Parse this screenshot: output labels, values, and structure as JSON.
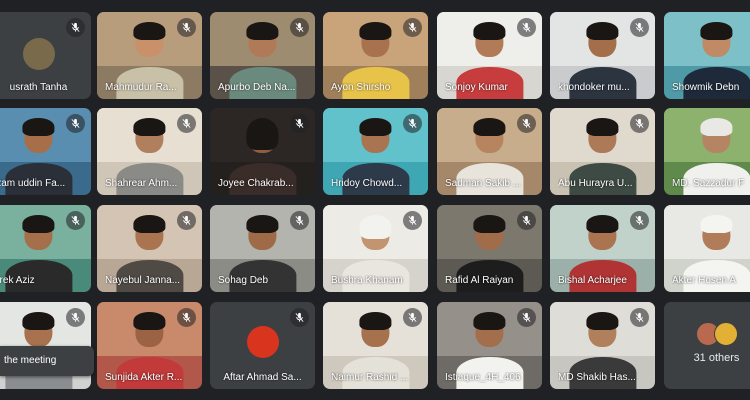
{
  "meeting": {
    "participants": [
      {
        "name": "Nusrath Tanha",
        "shown_name": "usrath Tanha",
        "muted": true,
        "avatar": "photo-icon"
      },
      {
        "name": "Mahmudur Ra...",
        "shown_name": "Mahmudur Ra...",
        "muted": true
      },
      {
        "name": "Apurbo Deb Na...",
        "shown_name": "Apurbo Deb Na...",
        "muted": true
      },
      {
        "name": "Ayon Shirsho",
        "shown_name": "Ayon Shirsho",
        "muted": true
      },
      {
        "name": "Sonjoy Kumar",
        "shown_name": "Sonjoy Kumar",
        "muted": true
      },
      {
        "name": "khondoker mu...",
        "shown_name": "khondoker mu...",
        "muted": true
      },
      {
        "name": "Showmik Debn...",
        "shown_name": "Showmik Debn",
        "muted": false
      },
      {
        "name": "Nizam uddin Fa...",
        "shown_name": "izam uddin Fa...",
        "muted": true
      },
      {
        "name": "Shahrear Ahm...",
        "shown_name": "Shahrear Ahm...",
        "muted": true
      },
      {
        "name": "Joyee Chakrab...",
        "shown_name": "Joyee Chakrab...",
        "muted": true
      },
      {
        "name": "Hridoy Chowd...",
        "shown_name": "Hridoy Chowd...",
        "muted": true
      },
      {
        "name": "Sadman Sakib ...",
        "shown_name": "Sadman Sakib ...",
        "muted": true
      },
      {
        "name": "Abu Hurayra U...",
        "shown_name": "Abu Hurayra U...",
        "muted": true
      },
      {
        "name": "MD. Sazzadur R...",
        "shown_name": "MD. Sazzadur F",
        "muted": false
      },
      {
        "name": "Tarek Aziz",
        "shown_name": "arek Aziz",
        "muted": true
      },
      {
        "name": "Nayebul Janna...",
        "shown_name": "Nayebul Janna...",
        "muted": true
      },
      {
        "name": "Sohag Deb",
        "shown_name": "Sohag Deb",
        "muted": true
      },
      {
        "name": "Bushra Khanam",
        "shown_name": "Bushra Khanam",
        "muted": true
      },
      {
        "name": "Rafid Al Raiyan",
        "shown_name": "Rafid Al Raiyan",
        "muted": true
      },
      {
        "name": "Bishal Acharjee",
        "shown_name": "Bishal Acharjee",
        "muted": true
      },
      {
        "name": "Akter Hosen A...",
        "shown_name": "Akter Hosen A",
        "muted": false
      },
      {
        "name": "",
        "shown_name": "",
        "muted": true
      },
      {
        "name": "Sunjida Akter R...",
        "shown_name": "Sunjida Akter R...",
        "muted": true
      },
      {
        "name": "Aftar Ahmad Sa...",
        "shown_name": "Aftar Ahmad Sa...",
        "muted": true,
        "avatar": "photo-icon"
      },
      {
        "name": "Naimur Rashid ...",
        "shown_name": "Naimur Rashid ...",
        "muted": true
      },
      {
        "name": "Istiaque_4H_406",
        "shown_name": "Istiaque_4H_406",
        "muted": true
      },
      {
        "name": "MD Shakib Has...",
        "shown_name": "MD Shakib Has...",
        "muted": true
      }
    ],
    "others": {
      "label": "31 others"
    },
    "toast": {
      "text": "the meeting"
    }
  },
  "colors": {
    "background": "#202124",
    "tile": "#3c4043",
    "text": "#ffffff"
  }
}
